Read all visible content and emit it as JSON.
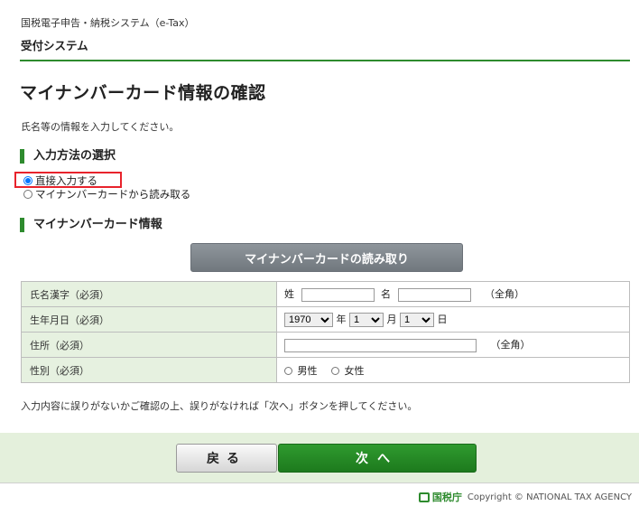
{
  "header": {
    "system_title": "国税電子申告・納税システム（e-Tax）",
    "sub_title": "受付システム"
  },
  "page_title": "マイナンバーカード情報の確認",
  "instruction": "氏名等の情報を入力してください。",
  "input_method": {
    "heading": "入力方法の選択",
    "option_direct": "直接入力する",
    "option_card": "マイナンバーカードから読み取る",
    "selected": "直接入力する"
  },
  "card_info": {
    "heading": "マイナンバーカード情報",
    "read_button": "マイナンバーカードの読み取り"
  },
  "form": {
    "name_label": "氏名漢字（必須）",
    "sei": "姓",
    "mei": "名",
    "zenkaku": "（全角）",
    "birth_label": "生年月日（必須）",
    "year_value": "1970",
    "year_unit": "年",
    "month_value": "1",
    "month_unit": "月",
    "day_value": "1",
    "day_unit": "日",
    "address_label": "住所（必須）",
    "address_zenkaku": "（全角）",
    "gender_label": "性別（必須）",
    "male": "男性",
    "female": "女性"
  },
  "note": "入力内容に誤りがないかご確認の上、誤りがなければ「次へ」ボタンを押してください。",
  "buttons": {
    "back": "戻る",
    "next": "次へ"
  },
  "footer": {
    "agency": "国税庁",
    "copyright": "Copyright © NATIONAL TAX AGENCY"
  },
  "colors": {
    "accent_green": "#2e8b2e",
    "highlight_red": "#e8232c",
    "label_bg": "#e6f1e0"
  }
}
